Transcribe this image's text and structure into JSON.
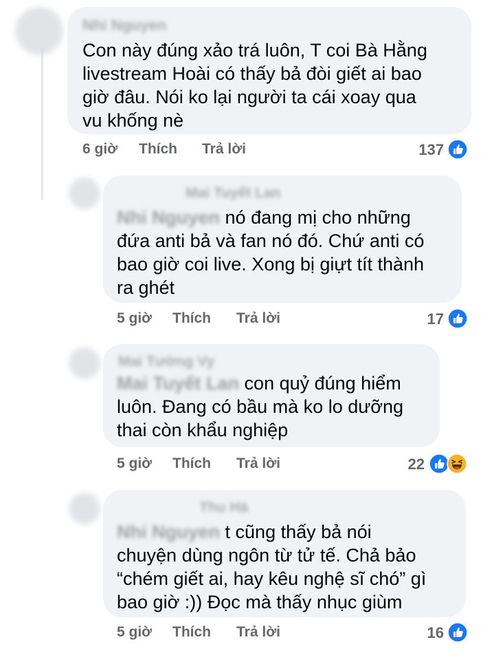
{
  "comments": [
    {
      "author": "Nhi Nguyen",
      "text": "Con này đúng xảo trá luôn, T coi Bà Hằng livestream Hoài có thấy bả đòi giết ai bao giờ đâu. Nói ko lại người ta cái xoay qua vu khống nè",
      "lines": [
        "Con này đúng xảo trá luôn, T coi Bà Hằng",
        "livestream Hoài có thấy bả đòi giết ai bao",
        "giờ đâu. Nói ko lại người ta cái xoay qua",
        "vu khống nè"
      ],
      "time": "6 giờ",
      "like_label": "Thích",
      "reply_label": "Trả lời",
      "reactions_count": "137",
      "reactions": [
        "like-icon"
      ]
    },
    {
      "author": "Mai Tuyết Lan",
      "mention": "Nhi Nguyen",
      "lines": [
        "nó đang mị cho những",
        "đứa anti bả và fan nó đó. Chứ anti có",
        "bao giờ coi live. Xong bị giựt tít thành",
        "ra ghét"
      ],
      "time": "5 giờ",
      "like_label": "Thích",
      "reply_label": "Trả lời",
      "reactions_count": "17",
      "reactions": [
        "like-icon"
      ]
    },
    {
      "author": "Mai Tường Vy",
      "mention": "Mai Tuyết Lan",
      "lines": [
        "con quỷ đúng hiểm",
        "luôn. Đang có bầu mà ko lo dưỡng",
        "thai còn khẩu nghiệp"
      ],
      "time": "5 giờ",
      "like_label": "Thích",
      "reply_label": "Trả lời",
      "reactions_count": "22",
      "reactions": [
        "like-icon",
        "haha-icon"
      ]
    },
    {
      "author": "Thu Hà",
      "mention": "Nhi Nguyen",
      "lines": [
        "t cũng thấy bả nói",
        "chuyện dùng ngôn từ tử tế. Chả bảo",
        "“chém giết ai, hay kêu nghệ sĩ chó” gì",
        "bao giờ :)) Đọc mà thấy nhục giùm"
      ],
      "time": "5 giờ",
      "like_label": "Thích",
      "reply_label": "Trả lời",
      "reactions_count": "16",
      "reactions": [
        "like-icon"
      ]
    }
  ],
  "colors": {
    "bubble": "#f0f2f5",
    "meta": "#65676b",
    "like_blue": "#1877f2",
    "haha_yellow": "#f7b125"
  }
}
